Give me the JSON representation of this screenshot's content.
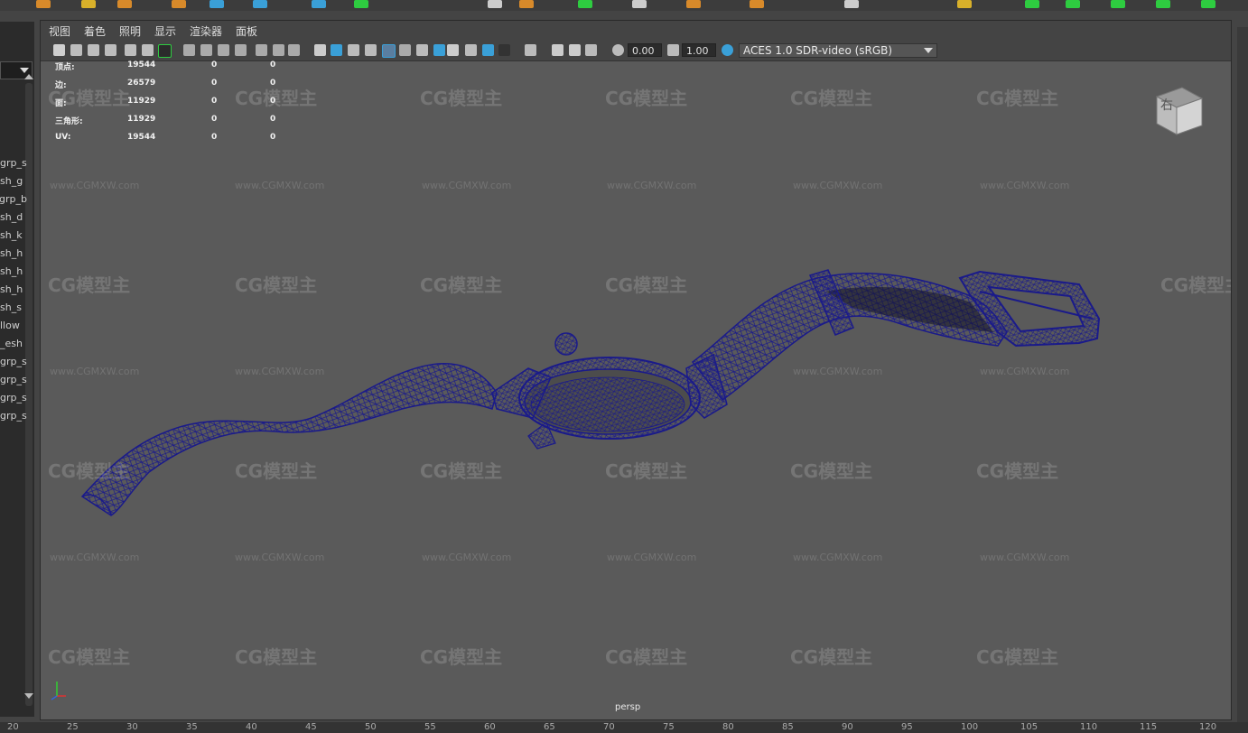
{
  "outliner": {
    "items": [
      "grp_s",
      "sh_g",
      "grp_b",
      "sh_d",
      "sh_k",
      "sh_h",
      "sh_h",
      "sh_h",
      "sh_s",
      "llow",
      "esh_",
      "grp_s",
      "grp_s",
      "grp_s",
      "grp_s"
    ]
  },
  "panel_menu": {
    "view": "视图",
    "shading": "着色",
    "lighting": "照明",
    "show": "显示",
    "renderer": "渲染器",
    "panels": "面板"
  },
  "toolbar": {
    "exposure": "0.00",
    "gamma": "1.00",
    "color_management": "ACES 1.0 SDR-video (sRGB)"
  },
  "hud": {
    "rows": [
      {
        "label": "顶点:",
        "v1": "19544",
        "v2": "0",
        "v3": "0"
      },
      {
        "label": "边:",
        "v1": "26579",
        "v2": "0",
        "v3": "0"
      },
      {
        "label": "面:",
        "v1": "11929",
        "v2": "0",
        "v3": "0"
      },
      {
        "label": "三角形:",
        "v1": "11929",
        "v2": "0",
        "v3": "0"
      },
      {
        "label": "UV:",
        "v1": "19544",
        "v2": "0",
        "v3": "0"
      }
    ]
  },
  "camera_label": "persp",
  "viewcube_label": "右",
  "watermark": {
    "logo": "CG模型主",
    "url": "www.CGMXW.com"
  },
  "ruler": [
    "20",
    "25",
    "30",
    "35",
    "40",
    "45",
    "50",
    "55",
    "60",
    "65",
    "70",
    "75",
    "80",
    "85",
    "90",
    "95",
    "100",
    "105",
    "110",
    "115",
    "120"
  ],
  "colors": {
    "viewport_bg": "#5a5a5a",
    "wireframe": "#1a1a8a",
    "accent_green": "#2ecc40",
    "accent_blue": "#3aa0d8"
  }
}
